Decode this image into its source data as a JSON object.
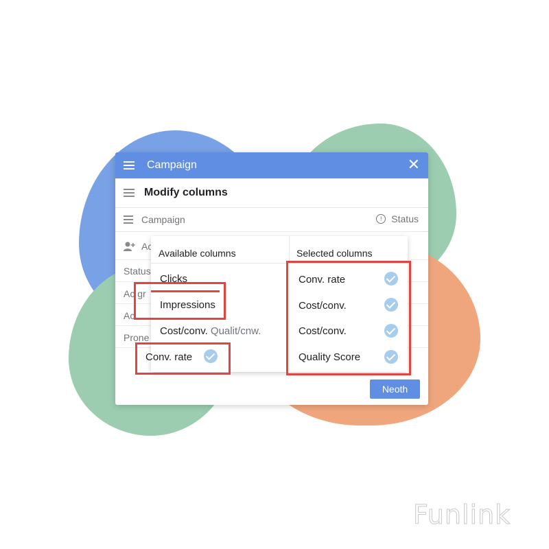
{
  "window": {
    "title": "Campaign",
    "close_glyph": "✕"
  },
  "modify": {
    "label": "Modify columns"
  },
  "toolbar": {
    "campaign": "Campaign",
    "status": "Status"
  },
  "background_rows": [
    "Ac",
    "Status",
    "Ac gr",
    "Ac",
    "Prone"
  ],
  "panel": {
    "available_header": "Available columns",
    "selected_header": "Selected columns",
    "available": {
      "clicks": "Clicks",
      "impressions": "Impressions",
      "cost_conv": "Cost/conv.",
      "qualit": "Qualit/cnw.",
      "conv_rate": "Conv. rate"
    },
    "selected": [
      "Conv. rate",
      "Cost/conv.",
      "Cost/conv.",
      "Quality Score"
    ]
  },
  "next_button": "Neoth",
  "watermark": "Funlink",
  "colors": {
    "accent": "#5f8ee3",
    "highlight_red": "#e0463f",
    "check": "#a6cdee",
    "blob_blue": "#79a1e6",
    "blob_green": "#9ccdb0",
    "blob_orange": "#f0a67d"
  }
}
